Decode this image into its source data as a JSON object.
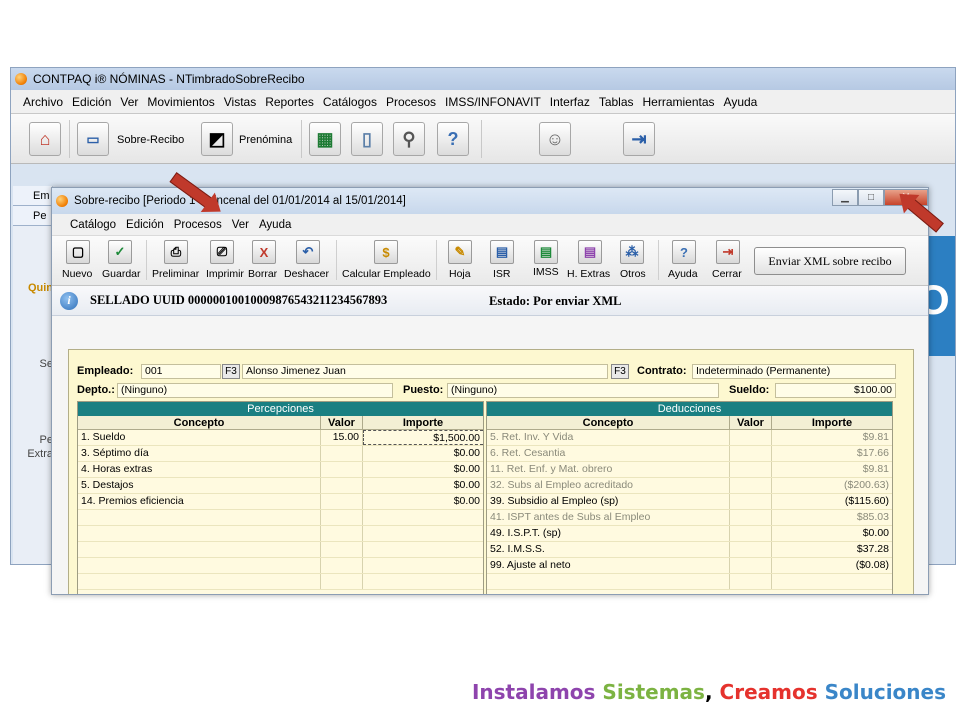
{
  "app": {
    "title": "CONTPAQ i® NÓMINAS - NTimbradoSobreRecibo",
    "menu": [
      "Archivo",
      "Edición",
      "Ver",
      "Movimientos",
      "Vistas",
      "Reportes",
      "Catálogos",
      "Procesos",
      "IMSS/INFONAVIT",
      "Interfaz",
      "Tablas",
      "Herramientas",
      "Ayuda"
    ],
    "toolbar": {
      "sobre_recibo": "Sobre-Recibo",
      "prenomina": "Prenómina"
    },
    "left_tabs": [
      "Em",
      "Pe"
    ],
    "left_items": [
      "Quin",
      "Se",
      "Pe",
      "Extra"
    ]
  },
  "window": {
    "title": "Sobre-recibo  [Periodo 1 Quincenal del 01/01/2014 al 15/01/2014]",
    "menu": [
      "Catálogo",
      "Edición",
      "Procesos",
      "Ver",
      "Ayuda"
    ],
    "toolbar": [
      "Nuevo",
      "Guardar",
      "Preliminar",
      "Imprimir",
      "Borrar",
      "Deshacer",
      "Calcular Empleado",
      "Hoja",
      "ISR",
      "IMSS",
      "H. Extras",
      "Otros",
      "Ayuda",
      "Cerrar"
    ],
    "xml_button": "Enviar XML sobre recibo",
    "uuid": "SELLADO UUID  000000100100098765432112345678​93",
    "estado": "Estado:  Por enviar XML"
  },
  "form": {
    "empleado_label": "Empleado:",
    "empleado_code": "001",
    "empleado_name": "Alonso Jimenez Juan",
    "f3": "F3",
    "contrato_label": "Contrato:",
    "contrato_value": "Indeterminado (Permanente)",
    "depto_label": "Depto.:",
    "depto_value": "(Ninguno)",
    "puesto_label": "Puesto:",
    "puesto_value": "(Ninguno)",
    "sueldo_label": "Sueldo:",
    "sueldo_value": "$100.00"
  },
  "percepciones": {
    "title": "Percepciones",
    "headers": [
      "Concepto",
      "Valor",
      "Importe"
    ],
    "rows": [
      {
        "concepto": "1. Sueldo",
        "valor": "15.00",
        "importe": "$1,500.00"
      },
      {
        "concepto": "3. Séptimo día",
        "valor": "",
        "importe": "$0.00"
      },
      {
        "concepto": "4. Horas extras",
        "valor": "",
        "importe": "$0.00"
      },
      {
        "concepto": "5. Destajos",
        "valor": "",
        "importe": "$0.00"
      },
      {
        "concepto": "14. Premios eficiencia",
        "valor": "",
        "importe": "$0.00"
      }
    ]
  },
  "deducciones": {
    "title": "Deducciones",
    "headers": [
      "Concepto",
      "Valor",
      "Importe"
    ],
    "rows": [
      {
        "concepto": "5. Ret. Inv. Y Vida",
        "valor": "",
        "importe": "$9.81",
        "gray": true
      },
      {
        "concepto": "6. Ret. Cesantia",
        "valor": "",
        "importe": "$17.66",
        "gray": true
      },
      {
        "concepto": "11. Ret. Enf. y Mat. obrero",
        "valor": "",
        "importe": "$9.81",
        "gray": true
      },
      {
        "concepto": "32. Subs al Empleo acreditado",
        "valor": "",
        "importe": "($200.63)",
        "gray": true
      },
      {
        "concepto": "39. Subsidio al Empleo (sp)",
        "valor": "",
        "importe": "($115.60)",
        "gray": false
      },
      {
        "concepto": "41. ISPT antes de Subs al Empleo",
        "valor": "",
        "importe": "$85.03",
        "gray": true
      },
      {
        "concepto": "49. I.S.P.T. (sp)",
        "valor": "",
        "importe": "$0.00",
        "gray": false
      },
      {
        "concepto": "52. I.M.S.S.",
        "valor": "",
        "importe": "$37.28",
        "gray": false
      },
      {
        "concepto": "99. Ajuste al neto",
        "valor": "",
        "importe": "($0.08)",
        "gray": false
      }
    ]
  },
  "slogan": {
    "w1": "Instalamos",
    "w2": "Sistemas",
    "comma": ",",
    "w3": "Creamos",
    "w4": "Soluciones",
    "c1": "#8e44ad",
    "c2": "#7cb342",
    "c3": "#e5322d",
    "c4": "#3a86c8"
  }
}
